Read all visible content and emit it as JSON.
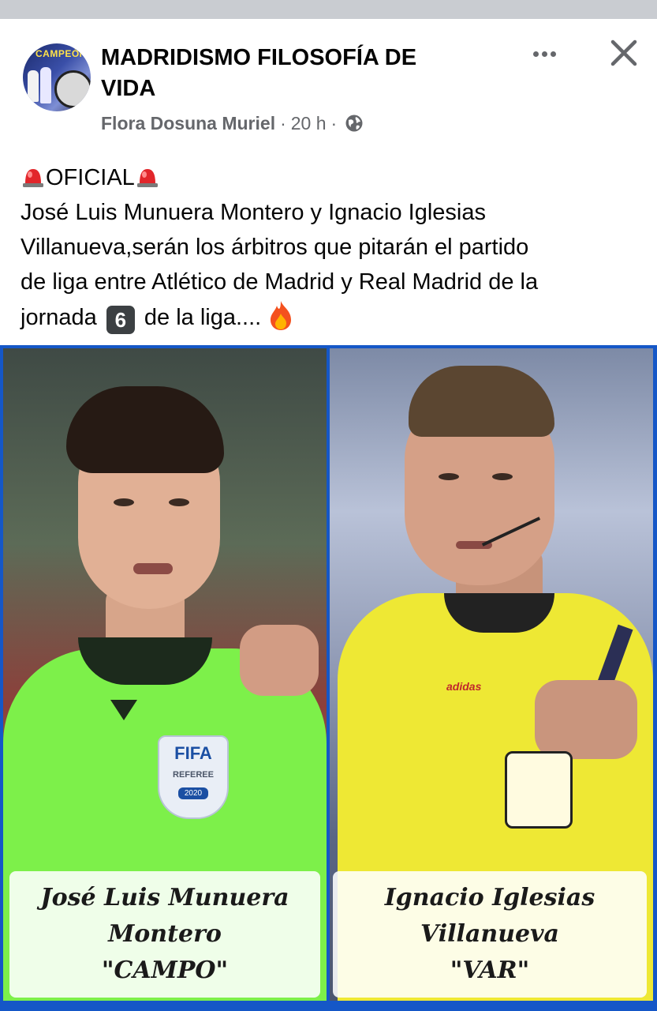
{
  "post": {
    "page_name": "MADRIDISMO FILOSOFÍA DE VIDA",
    "avatar_badge": "CAMPEÓN",
    "author": "Flora Dosuna Muriel",
    "separator_1": "·",
    "time": "20 h",
    "separator_2": "·",
    "privacy_icon": "globe-icon",
    "actions": {
      "more_icon": "more-options-icon",
      "close_icon": "close-icon"
    },
    "text": {
      "heading_emoji": "police-siren",
      "heading": "OFICIAL",
      "line1": "José Luis Munuera Montero y Ignacio Iglesias",
      "line2": "Villanueva,serán los árbitros  que pitarán el partido",
      "line3": "de liga entre Atlético de Madrid y Real Madrid de la",
      "line4_a": "jornada",
      "keycap": "6",
      "line4_b": "de la liga....",
      "trailing_emoji": "fire"
    }
  },
  "image": {
    "left": {
      "name_line1": "José Luis Munuera",
      "name_line2": "Montero",
      "role": "\"CAMPO\"",
      "badge_brand": "FIFA",
      "badge_sub": "REFEREE",
      "badge_year": "2020",
      "jersey_color": "#7df04a"
    },
    "right": {
      "name_line1": "Ignacio Iglesias",
      "name_line2": "Villanueva",
      "role": "\"VAR\"",
      "brand": "adidas",
      "jersey_color": "#eee834"
    },
    "border_color": "#1557c7"
  }
}
